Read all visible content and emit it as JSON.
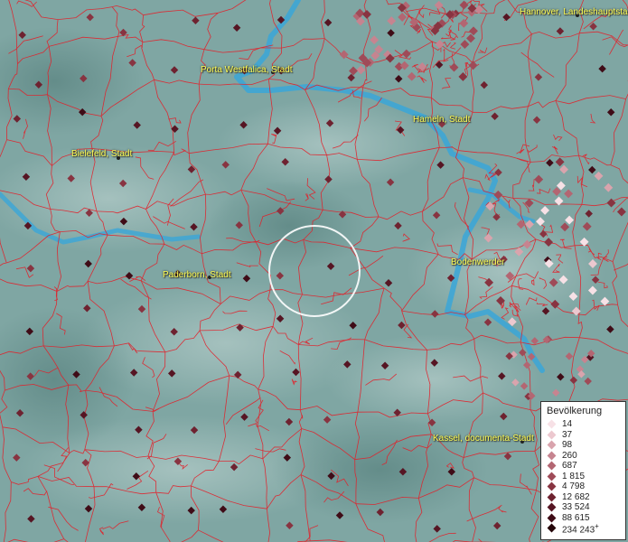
{
  "map": {
    "legend": {
      "title": "Bevölkerung",
      "classes": [
        {
          "label": "14",
          "color": "#f7e1e6"
        },
        {
          "label": "37",
          "color": "#ecc8cf"
        },
        {
          "label": "98",
          "color": "#d9a4ad"
        },
        {
          "label": "260",
          "color": "#c68490"
        },
        {
          "label": "687",
          "color": "#b36672"
        },
        {
          "label": "1 815",
          "color": "#9f4b58"
        },
        {
          "label": "4 798",
          "color": "#883441"
        },
        {
          "label": "12 682",
          "color": "#6e2230"
        },
        {
          "label": "33 524",
          "color": "#561523"
        },
        {
          "label": "88 615",
          "color": "#3f0c17"
        },
        {
          "label": "234 243",
          "color": "#250509",
          "plus": "+"
        }
      ]
    },
    "cities": [
      {
        "name": "Hannover, Landeshauptstadt"
      },
      {
        "name": "Porta Westfalica, Stadt"
      },
      {
        "name": "Hameln, Stadt"
      },
      {
        "name": "Bielefeld, Stadt"
      },
      {
        "name": "Paderborn, Stadt"
      },
      {
        "name": "Bodenwerder"
      },
      {
        "name": "Kassel, documenta-Stadt"
      }
    ],
    "colors": {
      "terrain": "#7fa6a3",
      "river": "#3aa6d8",
      "boundary": "#e2202a",
      "label": "#ffff55",
      "selection_circle": "#ffffff"
    }
  }
}
